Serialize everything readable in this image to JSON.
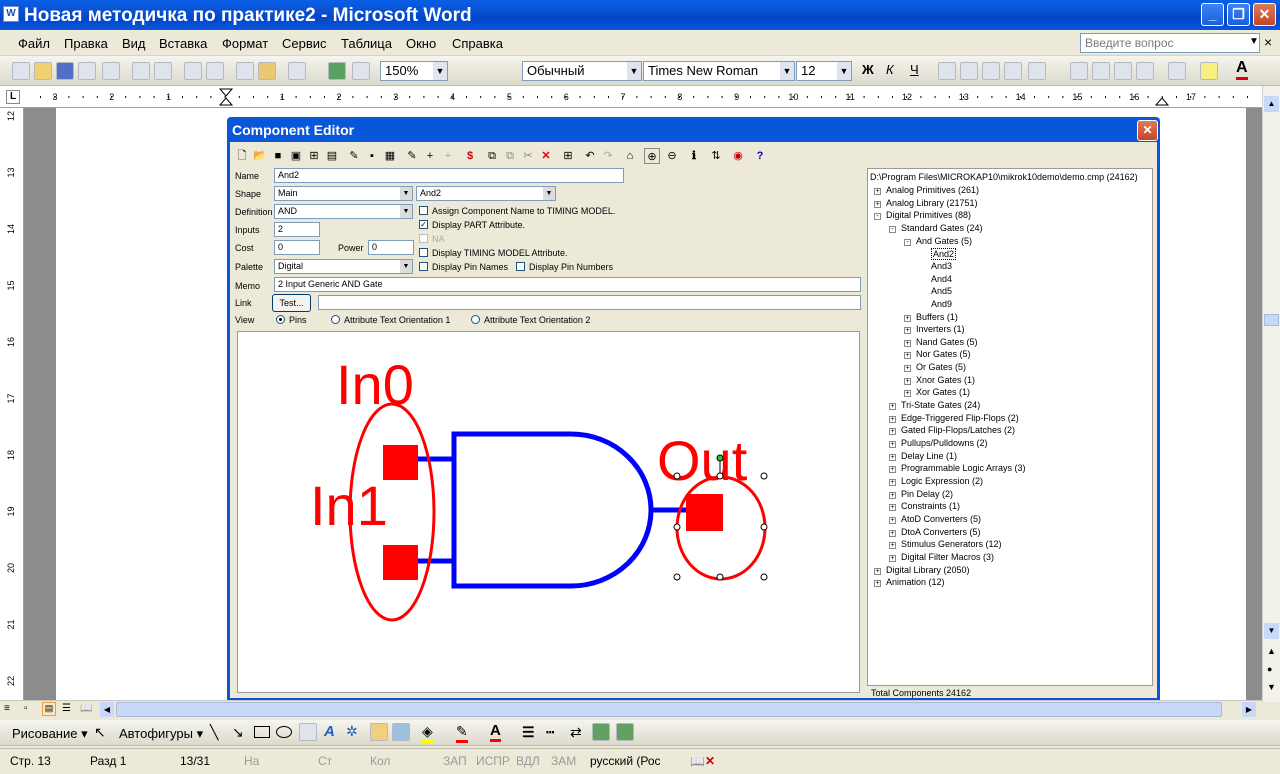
{
  "window": {
    "title": "Новая методичка по практике2 - Microsoft Word"
  },
  "menu": [
    "Файл",
    "Правка",
    "Вид",
    "Вставка",
    "Формат",
    "Сервис",
    "Таблица",
    "Окно",
    "Справка"
  ],
  "ask_placeholder": "Введите вопрос",
  "toolbar": {
    "zoom": "150%",
    "style": "Обычный",
    "font": "Times New Roman",
    "size": "12"
  },
  "ruler_numbers": [
    "3",
    "2",
    "1",
    "1",
    "2",
    "3",
    "4",
    "5",
    "6",
    "7",
    "8",
    "9",
    "10",
    "11",
    "12",
    "13",
    "14",
    "15",
    "16",
    "17"
  ],
  "left_ruler_numbers": [
    "12",
    "13",
    "14",
    "15",
    "16",
    "17",
    "18",
    "19",
    "20",
    "21",
    "22"
  ],
  "component_editor": {
    "title": "Component Editor",
    "name_label": "Name",
    "name_value": "And2",
    "shape_label": "Shape",
    "shape_value": "Main",
    "shape_value2": "And2",
    "definition_label": "Definition",
    "definition_value": "AND",
    "inputs_label": "Inputs",
    "inputs_value": "2",
    "cost_label": "Cost",
    "cost_value": "0",
    "power_label": "Power",
    "power_value": "0",
    "palette_label": "Palette",
    "palette_value": "Digital",
    "memo_label": "Memo",
    "memo_value": "2 Input Generic AND Gate",
    "link_label": "Link",
    "test_button": "Test...",
    "view_label": "View",
    "checks": [
      {
        "label": "Assign Component Name to TIMING MODEL.",
        "checked": false
      },
      {
        "label": "Display PART Attribute.",
        "checked": true
      },
      {
        "label": "NA",
        "checked": false,
        "disabled": true
      },
      {
        "label": "Display TIMING MODEL Attribute.",
        "checked": false
      },
      {
        "label": "Display Pin Names",
        "checked": false
      },
      {
        "label": "Display Pin Numbers",
        "checked": false
      }
    ],
    "radios": [
      {
        "label": "Pins",
        "checked": true
      },
      {
        "label": "Attribute Text Orientation 1",
        "checked": false
      },
      {
        "label": "Attribute Text Orientation 2",
        "checked": false
      }
    ],
    "pins": {
      "in0": "In0",
      "in1": "In1",
      "out": "Out"
    },
    "tree_path": "D:\\Program Files\\MICROKAP10\\mikrok10demo\\demo.cmp (24162)",
    "tree": [
      {
        "t": "Analog Primitives (261)",
        "lvl": 0,
        "exp": "+"
      },
      {
        "t": "Analog Library (21751)",
        "lvl": 0,
        "exp": "+"
      },
      {
        "t": "Digital Primitives (88)",
        "lvl": 0,
        "exp": "-"
      },
      {
        "t": "Standard Gates (24)",
        "lvl": 1,
        "exp": "-"
      },
      {
        "t": "And Gates (5)",
        "lvl": 2,
        "exp": "-"
      },
      {
        "t": "And2",
        "lvl": 3,
        "exp": "",
        "sel": true
      },
      {
        "t": "And3",
        "lvl": 3,
        "exp": ""
      },
      {
        "t": "And4",
        "lvl": 3,
        "exp": ""
      },
      {
        "t": "And5",
        "lvl": 3,
        "exp": ""
      },
      {
        "t": "And9",
        "lvl": 3,
        "exp": ""
      },
      {
        "t": "Buffers (1)",
        "lvl": 2,
        "exp": "+"
      },
      {
        "t": "Inverters (1)",
        "lvl": 2,
        "exp": "+"
      },
      {
        "t": "Nand Gates (5)",
        "lvl": 2,
        "exp": "+"
      },
      {
        "t": "Nor Gates (5)",
        "lvl": 2,
        "exp": "+"
      },
      {
        "t": "Or Gates (5)",
        "lvl": 2,
        "exp": "+"
      },
      {
        "t": "Xnor Gates (1)",
        "lvl": 2,
        "exp": "+"
      },
      {
        "t": "Xor Gates (1)",
        "lvl": 2,
        "exp": "+"
      },
      {
        "t": "Tri-State Gates (24)",
        "lvl": 1,
        "exp": "+"
      },
      {
        "t": "Edge-Triggered Flip-Flops (2)",
        "lvl": 1,
        "exp": "+"
      },
      {
        "t": "Gated Flip-Flops/Latches (2)",
        "lvl": 1,
        "exp": "+"
      },
      {
        "t": "Pullups/Pulldowns (2)",
        "lvl": 1,
        "exp": "+"
      },
      {
        "t": "Delay Line (1)",
        "lvl": 1,
        "exp": "+"
      },
      {
        "t": "Programmable Logic Arrays (3)",
        "lvl": 1,
        "exp": "+"
      },
      {
        "t": "Logic Expression (2)",
        "lvl": 1,
        "exp": "+"
      },
      {
        "t": "Pin Delay (2)",
        "lvl": 1,
        "exp": "+"
      },
      {
        "t": "Constraints (1)",
        "lvl": 1,
        "exp": "+"
      },
      {
        "t": "AtoD Converters (5)",
        "lvl": 1,
        "exp": "+"
      },
      {
        "t": "DtoA Converters (5)",
        "lvl": 1,
        "exp": "+"
      },
      {
        "t": "Stimulus Generators (12)",
        "lvl": 1,
        "exp": "+"
      },
      {
        "t": "Digital Filter Macros (3)",
        "lvl": 1,
        "exp": "+"
      },
      {
        "t": "Digital Library (2050)",
        "lvl": 0,
        "exp": "+"
      },
      {
        "t": "Animation (12)",
        "lvl": 0,
        "exp": "+"
      }
    ],
    "total": "Total Components 24162"
  },
  "drawbar": {
    "drawing": "Рисование",
    "autoshapes": "Автофигуры"
  },
  "status": {
    "page": "Стр. 13",
    "section": "Разд 1",
    "pages": "13/31",
    "at": "На",
    "line": "Ст",
    "col": "Кол",
    "rec": "ЗАП",
    "trk": "ИСПР",
    "ext": "ВДЛ",
    "ovr": "ЗАМ",
    "lang": "русский (Рос"
  },
  "colors": {
    "pin_color": "#ff0000",
    "gate_color": "#0000ff"
  }
}
